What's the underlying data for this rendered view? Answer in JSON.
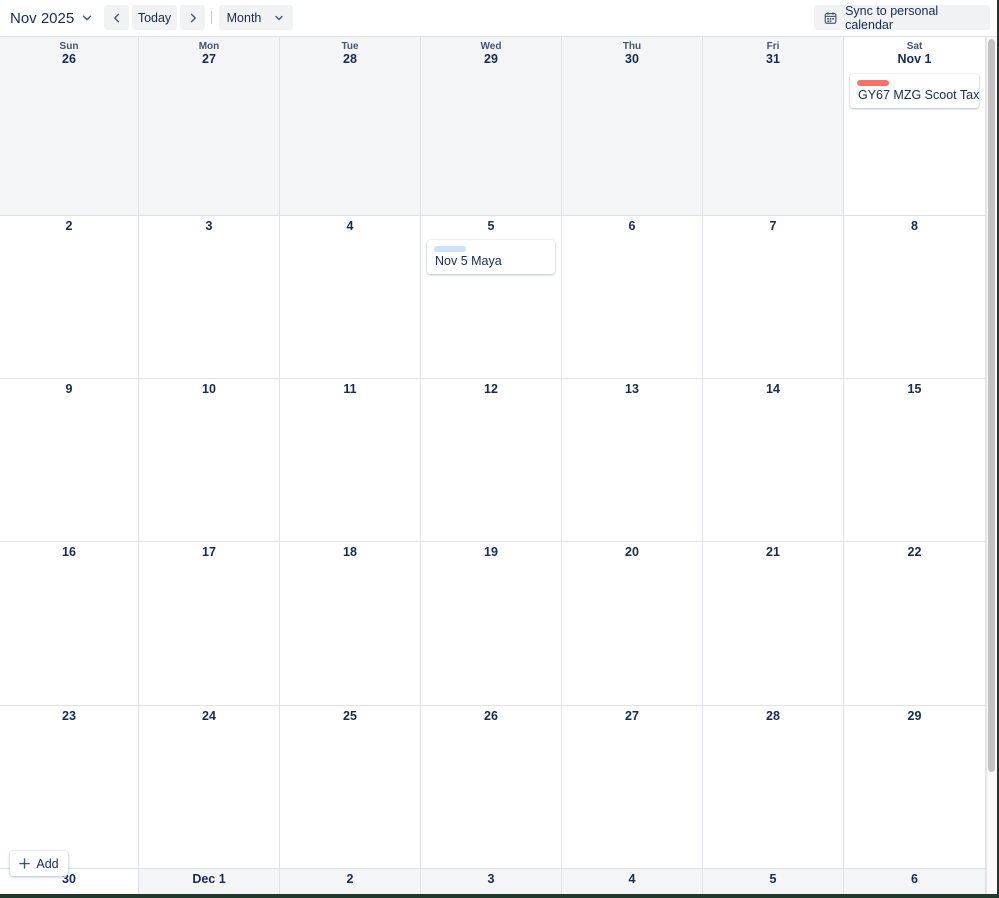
{
  "toolbar": {
    "month_label": "Nov 2025",
    "today_label": "Today",
    "view_label": "Month",
    "sync_label": "Sync to personal calendar"
  },
  "weekdays": [
    "Sun",
    "Mon",
    "Tue",
    "Wed",
    "Thu",
    "Fri",
    "Sat"
  ],
  "weeks": [
    {
      "days": [
        {
          "label": "26",
          "in_month": false
        },
        {
          "label": "27",
          "in_month": false
        },
        {
          "label": "28",
          "in_month": false
        },
        {
          "label": "29",
          "in_month": false
        },
        {
          "label": "30",
          "in_month": false
        },
        {
          "label": "31",
          "in_month": false
        },
        {
          "label": "Nov 1",
          "in_month": true
        }
      ]
    },
    {
      "days": [
        {
          "label": "2",
          "in_month": true
        },
        {
          "label": "3",
          "in_month": true
        },
        {
          "label": "4",
          "in_month": true
        },
        {
          "label": "5",
          "in_month": true
        },
        {
          "label": "6",
          "in_month": true
        },
        {
          "label": "7",
          "in_month": true
        },
        {
          "label": "8",
          "in_month": true
        }
      ]
    },
    {
      "days": [
        {
          "label": "9",
          "in_month": true
        },
        {
          "label": "10",
          "in_month": true
        },
        {
          "label": "11",
          "in_month": true
        },
        {
          "label": "12",
          "in_month": true
        },
        {
          "label": "13",
          "in_month": true
        },
        {
          "label": "14",
          "in_month": true
        },
        {
          "label": "15",
          "in_month": true
        }
      ]
    },
    {
      "days": [
        {
          "label": "16",
          "in_month": true
        },
        {
          "label": "17",
          "in_month": true
        },
        {
          "label": "18",
          "in_month": true
        },
        {
          "label": "19",
          "in_month": true
        },
        {
          "label": "20",
          "in_month": true
        },
        {
          "label": "21",
          "in_month": true
        },
        {
          "label": "22",
          "in_month": true
        }
      ]
    },
    {
      "days": [
        {
          "label": "23",
          "in_month": true
        },
        {
          "label": "24",
          "in_month": true
        },
        {
          "label": "25",
          "in_month": true
        },
        {
          "label": "26",
          "in_month": true
        },
        {
          "label": "27",
          "in_month": true
        },
        {
          "label": "28",
          "in_month": true
        },
        {
          "label": "29",
          "in_month": true
        }
      ]
    },
    {
      "days": [
        {
          "label": "30",
          "in_month": true
        },
        {
          "label": "Dec 1",
          "in_month": false
        },
        {
          "label": "2",
          "in_month": false
        },
        {
          "label": "3",
          "in_month": false
        },
        {
          "label": "4",
          "in_month": false
        },
        {
          "label": "5",
          "in_month": false
        },
        {
          "label": "6",
          "in_month": false
        }
      ]
    }
  ],
  "events": [
    {
      "title": "GY67 MZG Scoot Tax",
      "week": 0,
      "day": 6,
      "color": "#f87168"
    },
    {
      "title": "Nov 5 Maya",
      "week": 1,
      "day": 3,
      "color": "#cce0ff"
    }
  ],
  "add_button": {
    "label": "Add"
  },
  "icons": {
    "month_dropdown": "chevron-down-icon",
    "prev": "chevron-left-icon",
    "next": "chevron-right-icon",
    "view_dropdown": "chevron-down-icon",
    "sync": "calendar-icon",
    "add": "plus-icon"
  },
  "colors": {
    "out_of_month_bg": "#f4f5f7",
    "grid_line": "#dfe1e6",
    "button_bg": "#f1f2f4"
  }
}
